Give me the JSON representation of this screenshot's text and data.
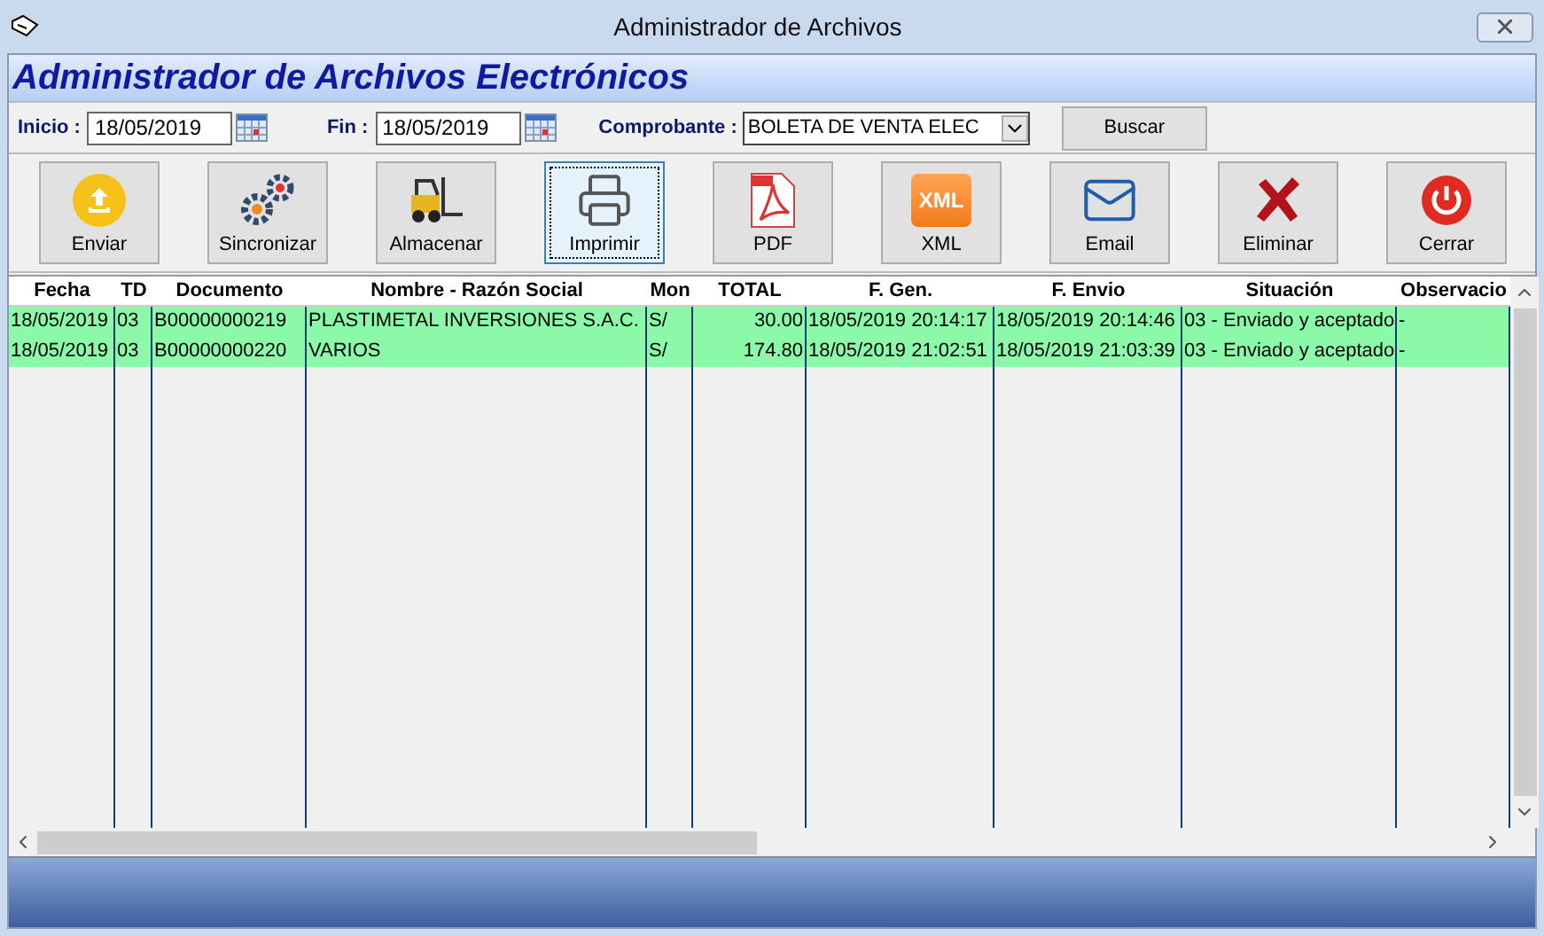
{
  "window": {
    "title": "Administrador de Archivos"
  },
  "header": {
    "title": "Administrador de Archivos Electrónicos"
  },
  "filters": {
    "start_label": "Inicio :",
    "start_value": "18/05/2019",
    "end_label": "Fin :",
    "end_value": "18/05/2019",
    "type_label": "Comprobante :",
    "type_value": "BOLETA DE VENTA ELEC",
    "search_button": "Buscar"
  },
  "toolbar": [
    {
      "label": "Enviar",
      "focused": false
    },
    {
      "label": "Sincronizar",
      "focused": false
    },
    {
      "label": "Almacenar",
      "focused": false
    },
    {
      "label": "Imprimir",
      "focused": true
    },
    {
      "label": "PDF",
      "focused": false
    },
    {
      "label": "XML",
      "icon_text": "XML",
      "focused": false
    },
    {
      "label": "Email",
      "focused": false
    },
    {
      "label": "Eliminar",
      "focused": false
    },
    {
      "label": "Cerrar",
      "focused": false
    }
  ],
  "table": {
    "columns": [
      "Fecha",
      "TD",
      "Documento",
      "Nombre - Razón Social",
      "Mon",
      "TOTAL",
      "F. Gen.",
      "F. Envio",
      "Situación",
      "Observacio"
    ],
    "rows": [
      {
        "selected": true,
        "cells": [
          "18/05/2019",
          "03",
          "B00000000219",
          "PLASTIMETAL INVERSIONES S.A.C.",
          "S/",
          "30.00",
          "18/05/2019 20:14:17",
          "18/05/2019 20:14:46",
          "03 - Enviado y aceptado",
          "-"
        ]
      },
      {
        "selected": true,
        "cells": [
          "18/05/2019",
          "03",
          "B00000000220",
          "VARIOS",
          "S/",
          "174.80",
          "18/05/2019 21:02:51",
          "18/05/2019 21:03:39",
          "03 - Enviado y aceptado",
          "-"
        ]
      }
    ]
  }
}
